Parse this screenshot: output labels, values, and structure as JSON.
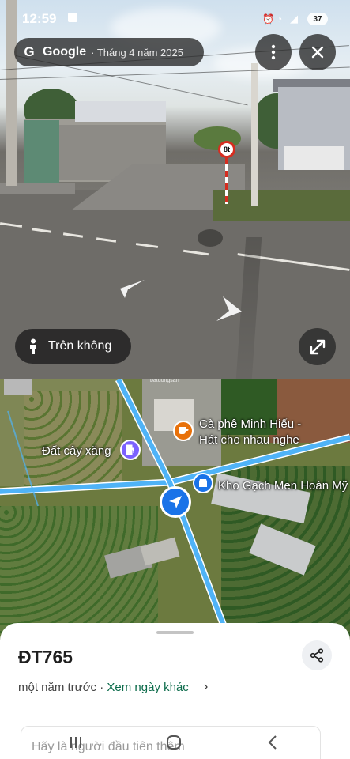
{
  "status_bar": {
    "time": "12:59",
    "battery": "37"
  },
  "streetview": {
    "brand": "Google",
    "date_label": "· Tháng 4 năm 2025",
    "speed_sign": "8t",
    "aerial_view_label": "Trên không"
  },
  "map": {
    "pois": [
      {
        "name": "Cà phê Minh Hiếu -",
        "name2": "Hát cho nhau nghe",
        "icon": "coffee-icon",
        "color": "#e8710a"
      },
      {
        "name": "Đất cây xăng",
        "icon": "gas-station-icon",
        "color": "#7b61ff"
      },
      {
        "name": "Kho Gạch Men Hoàn Mỹ",
        "icon": "store-icon",
        "color": "#1a73e8"
      }
    ],
    "road_color": "#4fb3f7"
  },
  "sheet": {
    "title": "ĐT765",
    "subtitle": "một năm trước ·",
    "link": "Xem ngày khác",
    "chevron": "›",
    "review_prompt": "Hãy là người đầu tiên thêm"
  }
}
